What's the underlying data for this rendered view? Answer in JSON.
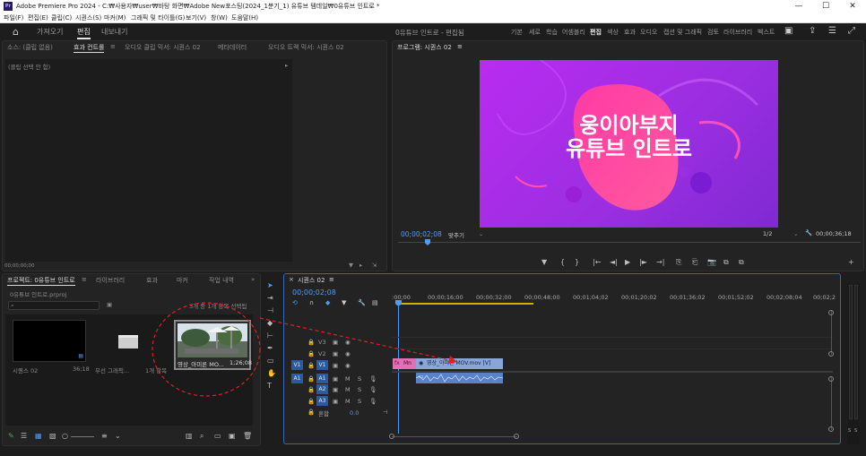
{
  "window": {
    "logo": "Pr",
    "title": "Adobe Premiere Pro 2024 - C:₩사용자₩user₩바탕 화면₩Adobe New포스팅(2024_1분기_1) 유튜브 템데일₩0유튜브 인트로 *",
    "minimize": "—",
    "maximize": "☐",
    "close": "✕"
  },
  "menu": [
    "파일(F)",
    "편집(E)",
    "클립(C)",
    "시퀀스(S)",
    "마커(M)",
    "그래픽 및 타이틀(G)",
    "보기(V)",
    "창(W)",
    "도움말(H)"
  ],
  "header": {
    "tabs": [
      "가져오기",
      "편집",
      "내보내기"
    ],
    "active_tab": "편집",
    "project_title": "0유튜브 인트로 - 편집됨",
    "workspaces": [
      "기본",
      "세로",
      "학습",
      "어셈블리",
      "편집",
      "색상",
      "효과",
      "오디오",
      "캡션 및 그래픽",
      "검토",
      "라이브러리",
      "벡스트"
    ],
    "active_workspace": "편집"
  },
  "source_panel": {
    "tabs": [
      "소스: (클립 없음)",
      "효과 컨트롤",
      "오디오 클립 믹서: 시퀀스 02",
      "메타데이터",
      "오디오 트랙 믹서: 시퀀스 02"
    ],
    "active_tab": "효과 컨트롤",
    "tab_menu": "≡",
    "no_clip": "(클립 선택 안 함)",
    "timecode": "00;00;00;00"
  },
  "program_panel": {
    "title": "프로그램: 시퀀스 02",
    "tab_menu": "≡",
    "video_line1": "웅이아부지",
    "video_line2": "유튜브 인트로",
    "timecode": "00;00;02;08",
    "fit": "맞추기",
    "scale": "1/2",
    "duration": "00;00;36;18",
    "controls": [
      "▼",
      "{",
      "}",
      "|←",
      "◄|",
      "▶",
      "|►",
      "→|",
      "⎘",
      "⎗",
      "📷",
      "⧉",
      "⧉"
    ],
    "add": "+"
  },
  "project_panel": {
    "tabs": [
      "프로젝트: 0유튜브 인트로",
      "라이브러리",
      "효과",
      "마커",
      "작업 내역"
    ],
    "active_tab": "프로젝트: 0유튜브 인트로",
    "tab_menu": "≡",
    "overflow": "»",
    "file": "0유튜브 인트로.prproj",
    "selection": "3개 중 1개 항목 선택됨",
    "search_placeholder": "",
    "items": [
      {
        "name": "시퀀스 02",
        "meta": "36;18"
      },
      {
        "name": "무선 그래픽...",
        "meta": "1개 항목"
      },
      {
        "name": "영상_아미론 MO...",
        "meta": "1;26;08"
      }
    ]
  },
  "timeline": {
    "title": "시퀀스 02",
    "tab_menu": "≡",
    "timecode": "00;00;02;08",
    "ruler": [
      ":00;00",
      "00;00;16;00",
      "00;00;32;00",
      "00;00;48;00",
      "00;01;04;02",
      "00;01;20;02",
      "00;01;36;02",
      "00;01;52;02",
      "00;02;08;04",
      "00;02;2"
    ],
    "video_tracks": [
      "V3",
      "V2",
      "V1"
    ],
    "audio_tracks": [
      "A1",
      "A2",
      "A3"
    ],
    "source_v": "V1",
    "source_a": "A1",
    "mix_label": "혼합",
    "mix_value": "0.0",
    "clip_mn": "Mn",
    "clip_video": "영상_아미론 MOV.mov [V]",
    "meter_labels": [
      "S",
      "S"
    ]
  },
  "colors": {
    "accent": "#4c9dff",
    "pink_clip": "#e36fb4",
    "blue_clip": "#8aa6d8",
    "annotation": "#e02020"
  }
}
